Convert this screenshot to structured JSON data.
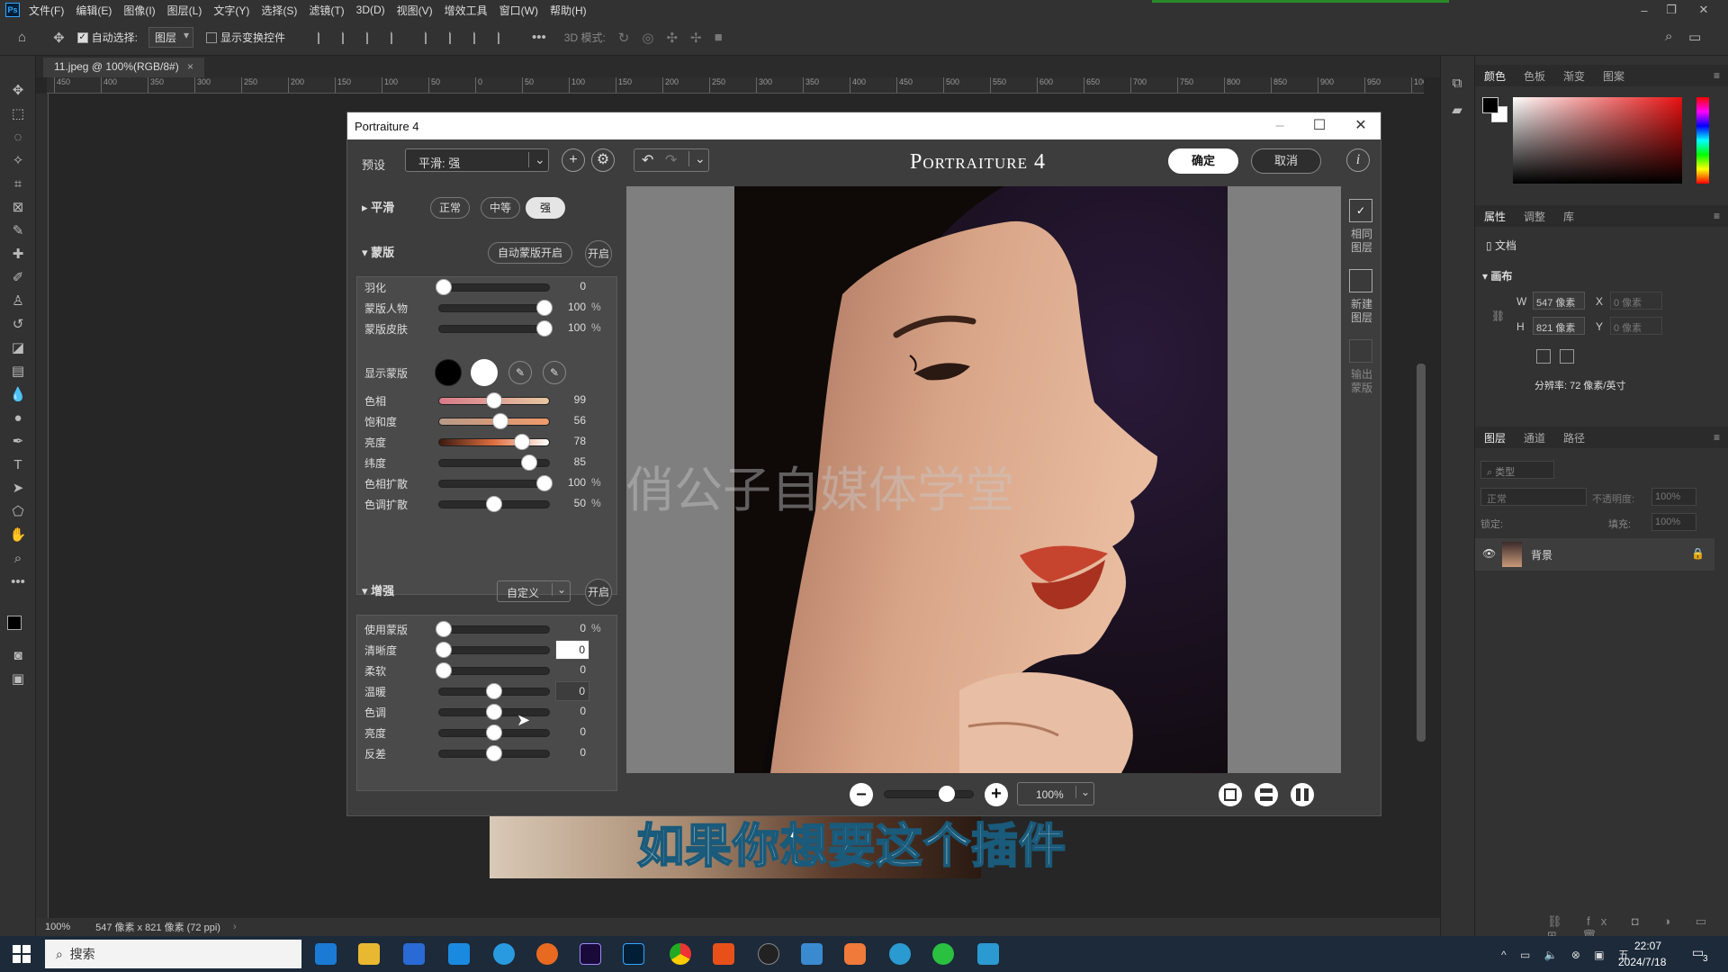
{
  "menu": [
    "文件(F)",
    "编辑(E)",
    "图像(I)",
    "图层(L)",
    "文字(Y)",
    "选择(S)",
    "滤镜(T)",
    "3D(D)",
    "视图(V)",
    "增效工具",
    "窗口(W)",
    "帮助(H)"
  ],
  "options": {
    "auto_select": "自动选择:",
    "layer": "图层",
    "show_transform": "显示变换控件",
    "mode_3d": "3D 模式:"
  },
  "doc_tab": "11.jpeg @ 100%(RGB/8#)",
  "ruler_ticks": [
    "450",
    "400",
    "350",
    "300",
    "250",
    "200",
    "150",
    "100",
    "50",
    "0",
    "50",
    "100",
    "150",
    "200",
    "250",
    "300",
    "350",
    "400",
    "450",
    "500",
    "550",
    "600",
    "650",
    "700",
    "750",
    "800",
    "850",
    "900",
    "950",
    "1000"
  ],
  "status": {
    "zoom": "100%",
    "info": "547 像素 x 821 像素 (72 ppi)"
  },
  "right": {
    "color_tabs": [
      "颜色",
      "色板",
      "渐变",
      "图案"
    ],
    "props_tabs": [
      "属性",
      "调整",
      "库"
    ],
    "doc_label": "文档",
    "canvas_label": "画布",
    "w_label": "W",
    "w_value": "547 像素",
    "x_label": "X",
    "x_placeholder": "0 像素",
    "h_label": "H",
    "h_value": "821 像素",
    "y_label": "Y",
    "y_placeholder": "0 像素",
    "resolution": "分辨率: 72 像素/英寸",
    "layer_tabs": [
      "图层",
      "通道",
      "路径"
    ],
    "kind": "类型",
    "blend": "正常",
    "opacity_label": "不透明度:",
    "opacity": "100%",
    "lock_label": "锁定:",
    "fill_label": "填充:",
    "fill": "100%",
    "layer_name": "背景"
  },
  "plugin": {
    "title": "Portraiture 4",
    "preset_label": "预设",
    "preset_value": "平滑: 强",
    "brand": "Portraiture 4",
    "ok": "确定",
    "cancel": "取消",
    "smooth": {
      "label": "平滑",
      "opts": [
        "正常",
        "中等",
        "强"
      ],
      "active": 2
    },
    "mask": {
      "label": "蒙版",
      "auto": "自动蒙版开启",
      "on": "开启",
      "rows": [
        {
          "label": "羽化",
          "value": "0",
          "unit": "",
          "pct": 0
        },
        {
          "label": "蒙版人物",
          "value": "100",
          "unit": "%",
          "pct": 100
        },
        {
          "label": "蒙版皮肤",
          "value": "100",
          "unit": "%",
          "pct": 100
        }
      ],
      "show_label": "显示蒙版",
      "colors": [
        {
          "label": "色相",
          "value": "99",
          "unit": "",
          "pct": 50
        },
        {
          "label": "饱和度",
          "value": "56",
          "unit": "",
          "pct": 56
        },
        {
          "label": "亮度",
          "value": "78",
          "unit": "",
          "pct": 78
        },
        {
          "label": "纬度",
          "value": "85",
          "unit": "",
          "pct": 85
        },
        {
          "label": "色相扩散",
          "value": "100",
          "unit": "%",
          "pct": 100
        },
        {
          "label": "色调扩散",
          "value": "50",
          "unit": "%",
          "pct": 50
        }
      ]
    },
    "enhance": {
      "label": "增强",
      "mode": "自定义",
      "on": "开启",
      "rows": [
        {
          "label": "使用蒙版",
          "value": "0",
          "unit": "%",
          "pct": 0
        },
        {
          "label": "清晰度",
          "value": "0",
          "unit": "",
          "pct": 0
        },
        {
          "label": "柔软",
          "value": "0",
          "unit": "",
          "pct": 0
        },
        {
          "label": "温暖",
          "value": "0",
          "unit": "",
          "pct": 50
        },
        {
          "label": "色调",
          "value": "0",
          "unit": "",
          "pct": 50
        },
        {
          "label": "亮度",
          "value": "0",
          "unit": "",
          "pct": 50
        },
        {
          "label": "反差",
          "value": "0",
          "unit": "",
          "pct": 50
        }
      ]
    },
    "side": [
      {
        "label": "相同\n图层",
        "checked": true
      },
      {
        "label": "新建\n图层",
        "checked": false
      },
      {
        "label": "输出\n蒙版",
        "checked": false
      }
    ],
    "zoom": "100%",
    "zoom_level": 0.7
  },
  "watermark": "俏公子自媒体学堂",
  "subtitle": "如果你想要这个插件",
  "taskbar": {
    "search": "搜索",
    "time": "22:07",
    "date": "2024/7/18",
    "notif": "3"
  }
}
